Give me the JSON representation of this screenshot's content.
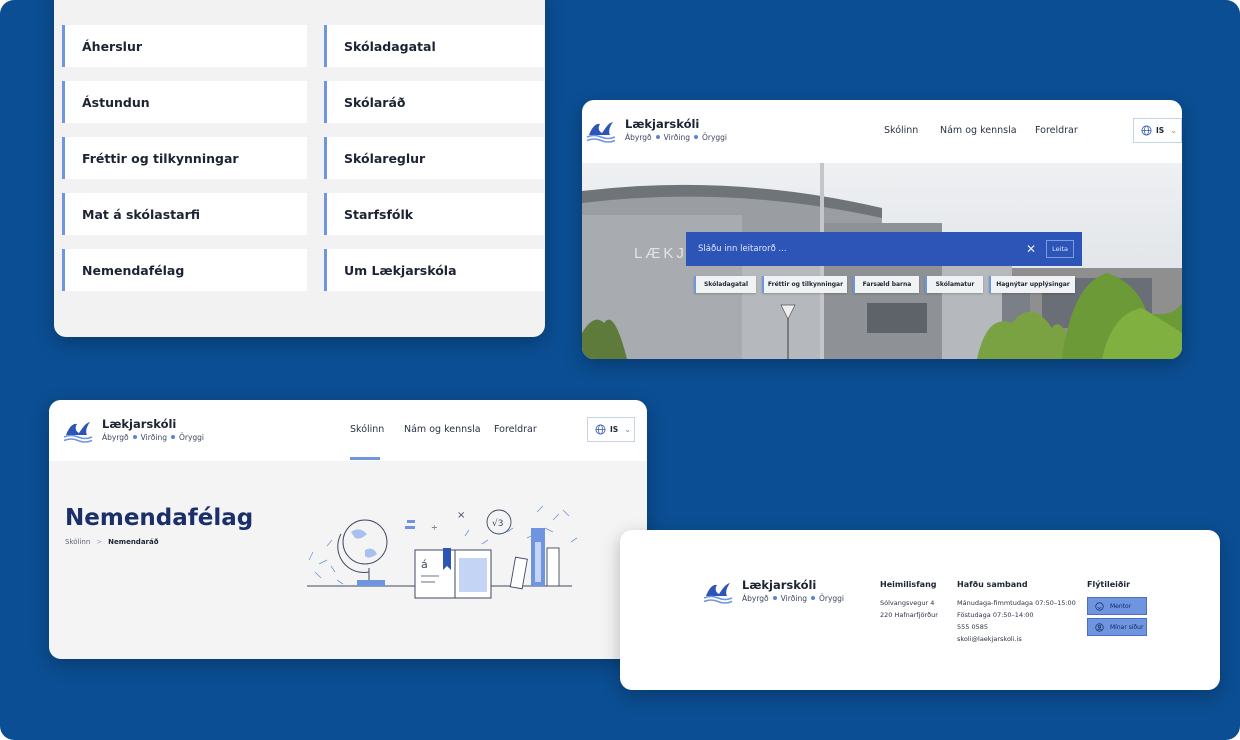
{
  "colors": {
    "background": "#0b4e93",
    "accent": "#6f95e0",
    "primary_dark": "#1b2f6b",
    "search_blue": "#2d55b8"
  },
  "brand": {
    "name": "Lækjarskóli",
    "motto": [
      "Ábyrgð",
      "Virðing",
      "Öryggi"
    ]
  },
  "links": {
    "left": [
      "Áherslur",
      "Ástundun",
      "Fréttir og tilkynningar",
      "Mat á skólastarfi",
      "Nemendafélag"
    ],
    "right": [
      "Skóladagatal",
      "Skólaráð",
      "Skólareglur",
      "Starfsfólk",
      "Um Lækjarskóla"
    ]
  },
  "nav": {
    "items": [
      "Skólinn",
      "Nám og kennsla",
      "Foreldrar"
    ],
    "language": "IS",
    "active": "Skólinn"
  },
  "hero": {
    "search_placeholder": "Sláðu inn leitarorð ...",
    "search_button": "Leita",
    "quick_links": [
      "Skóladagatal",
      "Fréttir og tilkynningar",
      "Farsæld barna",
      "Skólamatur",
      "Hagnýtar upplýsingar"
    ],
    "sign_text": "LÆKJAR"
  },
  "page": {
    "title": "Nemendafélag",
    "breadcrumb": [
      "Skólinn",
      "Nemendaráð"
    ]
  },
  "footer": {
    "address_title": "Heimilisfang",
    "address": [
      "Sólvangsvegur 4",
      "220 Hafnarfjörður"
    ],
    "contact_title": "Hafðu samband",
    "contact": [
      "Mánudaga-fimmtudaga 07:50–15:00",
      "Föstudaga 07:50–14:00",
      "555 0585",
      "skoli@laekjarskoli.is"
    ],
    "shortcuts_title": "Flýtileiðir",
    "shortcuts": [
      "Mentor",
      "Mínar síður"
    ]
  }
}
